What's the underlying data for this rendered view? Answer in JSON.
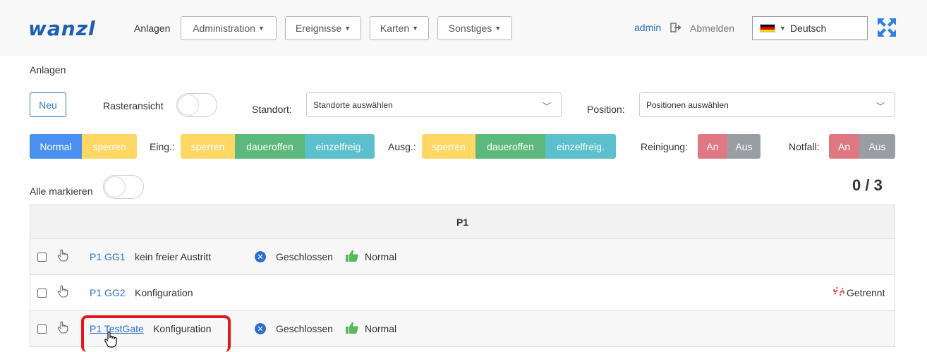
{
  "header": {
    "logo": "wanzl",
    "nav_link": "Anlagen",
    "menus": [
      {
        "label": "Administration"
      },
      {
        "label": "Ereignisse"
      },
      {
        "label": "Karten"
      },
      {
        "label": "Sonstiges"
      }
    ],
    "user": "admin",
    "logout": "Abmelden",
    "language": "Deutsch"
  },
  "page": {
    "title": "Anlagen"
  },
  "filters": {
    "new_button": "Neu",
    "grid_view_label": "Rasteransicht",
    "grid_view_on": false,
    "location_label": "Standort:",
    "location_placeholder": "Standorte auswählen",
    "position_label": "Position:",
    "position_placeholder": "Positionen auswählen"
  },
  "actions": {
    "normal": "Normal",
    "lock": "sperren",
    "entry_label": "Eing.:",
    "entry_buttons": [
      "sperren",
      "daueroffen",
      "einzelfreig."
    ],
    "exit_label": "Ausg.:",
    "exit_buttons": [
      "sperren",
      "daueroffen",
      "einzelfreig."
    ],
    "cleaning_label": "Reinigung:",
    "cleaning_on": "An",
    "cleaning_off": "Aus",
    "emergency_label": "Notfall:",
    "emergency_on": "An",
    "emergency_off": "Aus"
  },
  "select_all": {
    "label": "Alle markieren",
    "on": false,
    "counter": "0 / 3"
  },
  "table": {
    "group_header": "P1",
    "rows": [
      {
        "link": "P1 GG1",
        "state": "kein freier Austritt",
        "status": "Geschlossen",
        "mode": "Normal",
        "connection": ""
      },
      {
        "link": "P1 GG2",
        "state": "Konfiguration",
        "status": "",
        "mode": "",
        "connection": "Getrennt"
      },
      {
        "link": "P1 TestGate",
        "state": "Konfiguration",
        "status": "Geschlossen",
        "mode": "Normal",
        "connection": ""
      }
    ]
  },
  "colors": {
    "primary": "#4a90f0",
    "warning": "#ffd764",
    "success": "#5cb87c",
    "info": "#5bc0cc",
    "danger": "#e07883",
    "secondary": "#999ea5",
    "highlight": "#e8141c"
  }
}
